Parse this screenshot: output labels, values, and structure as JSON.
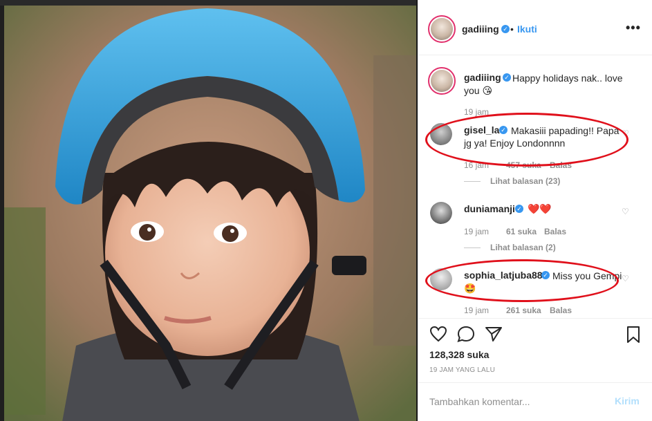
{
  "post": {
    "author": "gadiiing",
    "follow_label": "Ikuti",
    "dot": "•",
    "more_label": "•••",
    "likes": "128,328 suka",
    "time_ago": "19 JAM YANG LALU"
  },
  "caption": {
    "username": "gadiiing",
    "text": "Happy holidays nak.. love you 😘",
    "time": "19 jam"
  },
  "comments": [
    {
      "username": "gisel_la",
      "text": "Makasiii papading!! Papa jg ya! Enjoy Londonnnn",
      "time": "16 jam",
      "likes": "457 suka",
      "reply": "Balas",
      "view_replies": "Lihat balasan (23)"
    },
    {
      "username": "duniamanji",
      "text": "❤️❤️",
      "time": "19 jam",
      "likes": "61 suka",
      "reply": "Balas",
      "view_replies": "Lihat balasan (2)"
    },
    {
      "username": "sophia_latjuba88",
      "text": "Miss you Gempi 🤩",
      "time": "19 jam",
      "likes": "261 suka",
      "reply": "Balas"
    }
  ],
  "composer": {
    "placeholder": "Tambahkan komentar...",
    "post_label": "Kirim"
  },
  "colors": {
    "accent": "#3897f0",
    "annotation": "#e0101b",
    "helmet": "#3aa3dc"
  },
  "icons": [
    "verified-icon",
    "heart-icon",
    "comment-icon",
    "share-icon",
    "bookmark-icon",
    "more-icon"
  ]
}
